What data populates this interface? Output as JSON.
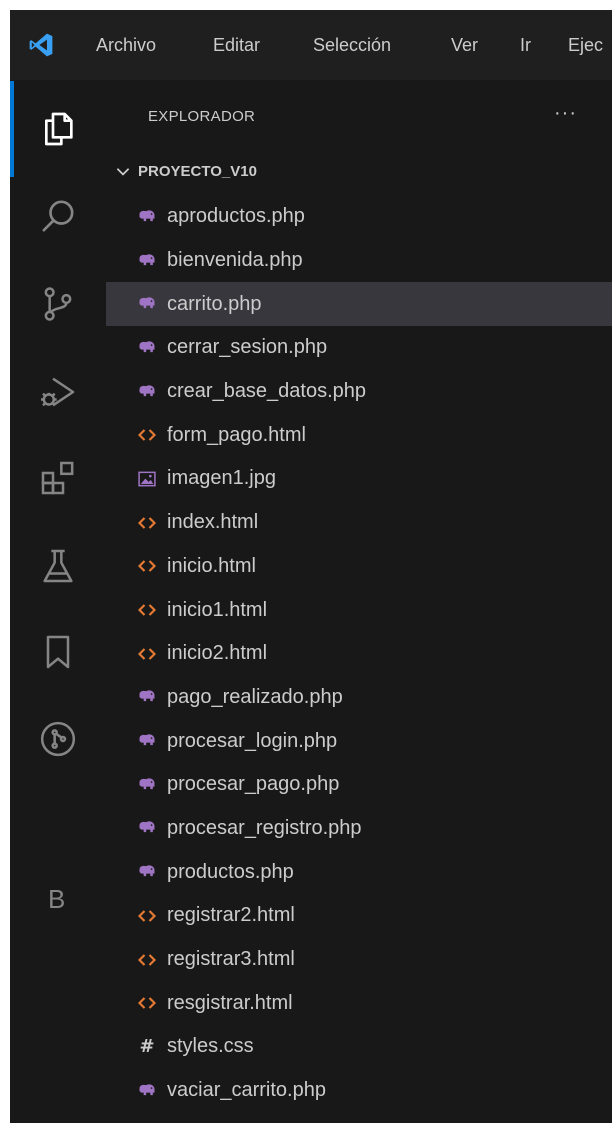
{
  "menubar": {
    "items": [
      "Archivo",
      "Editar",
      "Selección",
      "Ver",
      "Ir",
      "Ejec"
    ]
  },
  "activity_bar": {
    "items": [
      {
        "name": "explorer-icon",
        "active": true
      },
      {
        "name": "search-icon"
      },
      {
        "name": "source-control-icon"
      },
      {
        "name": "run-debug-icon"
      },
      {
        "name": "extensions-icon"
      },
      {
        "name": "testing-flask-icon"
      },
      {
        "name": "bookmarks-icon"
      },
      {
        "name": "git-graph-icon"
      }
    ],
    "letter_item": "B"
  },
  "explorer": {
    "title": "EXPLORADOR",
    "more_label": "···",
    "folder": "PROYECTO_V10",
    "files": [
      {
        "name": "aproductos.php",
        "type": "php"
      },
      {
        "name": "bienvenida.php",
        "type": "php"
      },
      {
        "name": "carrito.php",
        "type": "php",
        "selected": true
      },
      {
        "name": "cerrar_sesion.php",
        "type": "php"
      },
      {
        "name": "crear_base_datos.php",
        "type": "php"
      },
      {
        "name": "form_pago.html",
        "type": "html"
      },
      {
        "name": "imagen1.jpg",
        "type": "image"
      },
      {
        "name": "index.html",
        "type": "html"
      },
      {
        "name": "inicio.html",
        "type": "html"
      },
      {
        "name": "inicio1.html",
        "type": "html"
      },
      {
        "name": "inicio2.html",
        "type": "html"
      },
      {
        "name": "pago_realizado.php",
        "type": "php"
      },
      {
        "name": "procesar_login.php",
        "type": "php"
      },
      {
        "name": "procesar_pago.php",
        "type": "php"
      },
      {
        "name": "procesar_registro.php",
        "type": "php"
      },
      {
        "name": "productos.php",
        "type": "php"
      },
      {
        "name": "registrar2.html",
        "type": "html"
      },
      {
        "name": "registrar3.html",
        "type": "html"
      },
      {
        "name": "resgistrar.html",
        "type": "html"
      },
      {
        "name": "styles.css",
        "type": "css"
      },
      {
        "name": "vaciar_carrito.php",
        "type": "php"
      }
    ]
  },
  "colors": {
    "accent": "#0078d4",
    "php": "#a074c4",
    "html": "#e37933",
    "image": "#a074c4",
    "css": "#cccccc",
    "selected_row": "#37373d"
  }
}
